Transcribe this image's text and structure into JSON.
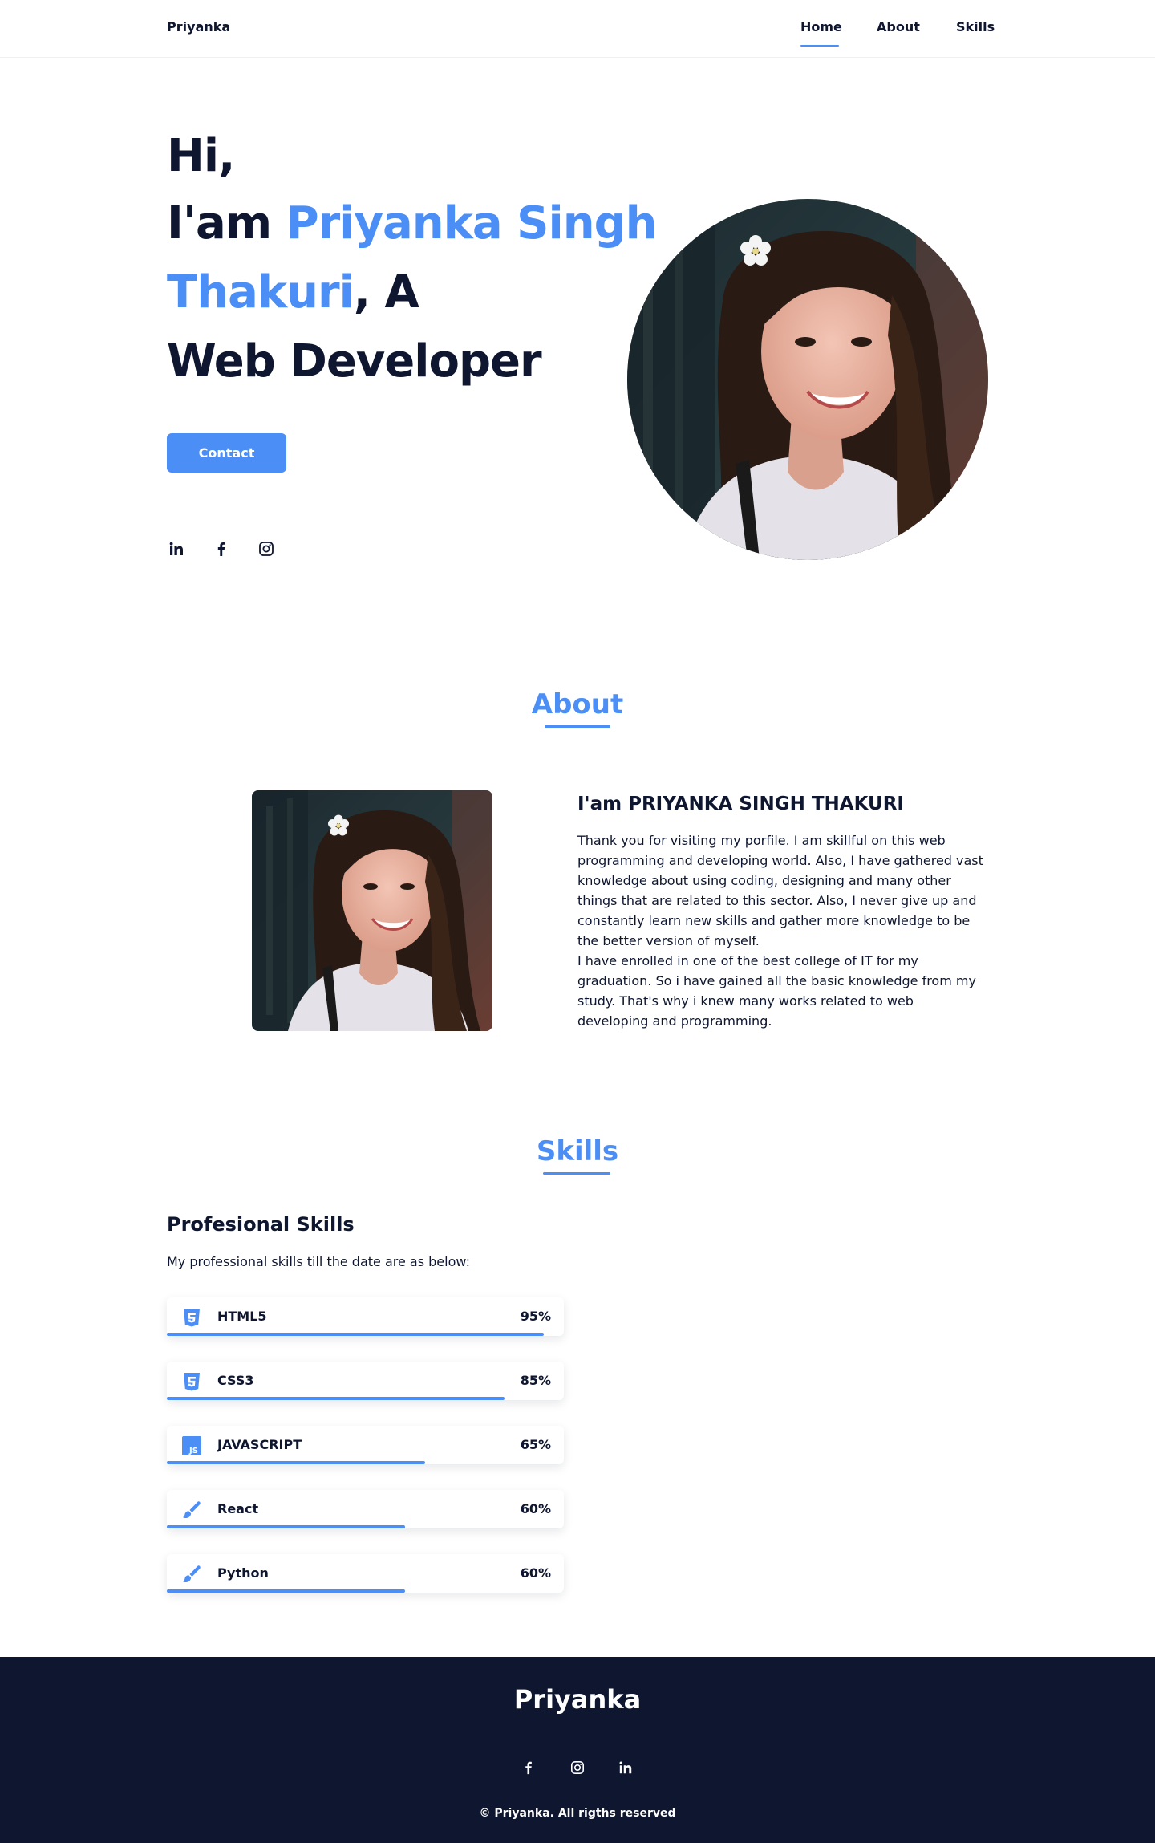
{
  "header": {
    "brand": "Priyanka",
    "nav": {
      "home": "Home",
      "about": "About",
      "skills": "Skills"
    }
  },
  "hero": {
    "line1": "Hi,",
    "line2_prefix": "I'am ",
    "line2_name": "Priyanka Singh",
    "line3_name": "Thakuri",
    "line3_suffix": ",  A",
    "line4": "Web Developer",
    "contact_label": "Contact",
    "socials": [
      "linkedin-icon",
      "facebook-icon",
      "instagram-icon"
    ]
  },
  "about": {
    "title": "About",
    "heading": "I'am PRIYANKA SINGH THAKURI",
    "paragraph1": "Thank you for visiting my porfile. I am skillful on this web programming and developing world. Also, I have gathered vast knowledge about using coding, designing and many other things that are related to this sector. Also, I never give up and constantly learn new skills and gather more knowledge to be the better version of myself.",
    "paragraph2": "I have enrolled in one of the best college of IT for my graduation. So i have gained all the basic knowledge from my study. That's why i knew many works related to web developing and programming."
  },
  "skills": {
    "title": "Skills",
    "subtitle": "Profesional Skills",
    "description": "My professional skills till the date are as below:",
    "items": [
      {
        "name": "HTML5",
        "percent": "95%",
        "level": 0.95,
        "icon": "html5-icon"
      },
      {
        "name": "CSS3",
        "percent": "85%",
        "level": 0.85,
        "icon": "css3-icon"
      },
      {
        "name": "JAVASCRIPT",
        "percent": "65%",
        "level": 0.65,
        "icon": "javascript-icon"
      },
      {
        "name": "React",
        "percent": "60%",
        "level": 0.6,
        "icon": "brush-icon"
      },
      {
        "name": "Python",
        "percent": "60%",
        "level": 0.6,
        "icon": "brush-icon"
      }
    ]
  },
  "footer": {
    "brand": "Priyanka",
    "socials": [
      "facebook-icon",
      "instagram-icon",
      "linkedin-icon"
    ],
    "copyright": "© Priyanka. All rigths reserved"
  },
  "colors": {
    "accent": "#4b8ef6",
    "dark": "#0e1630",
    "white": "#ffffff"
  }
}
